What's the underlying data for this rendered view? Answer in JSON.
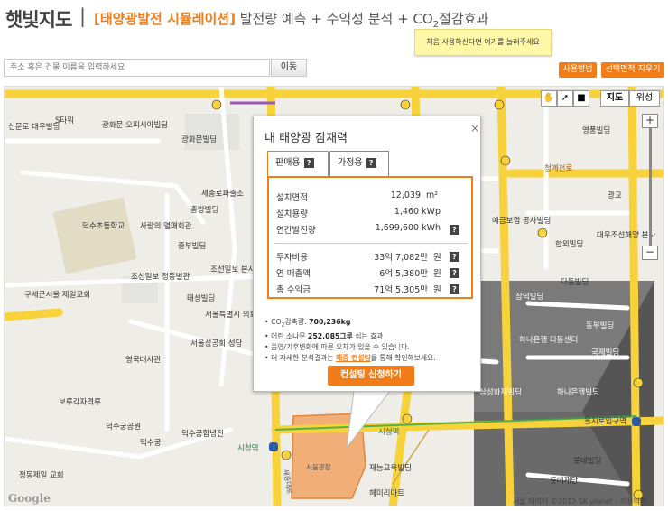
{
  "header": {
    "logo": "햇빛지도",
    "separator": "|",
    "title_highlight": "[태양광발전 시뮬레이션]",
    "title_rest": " 발전량 예측 + 수익성 분석 + CO",
    "title_sub": "2",
    "title_tail": "절감효과"
  },
  "tooltip": "처음 사용하신다면 여기를 눌러주세요",
  "search": {
    "placeholder": "주소 혹은 건물 이름을 입력하세요",
    "button": "이동"
  },
  "buttons": {
    "howto": "사용방법",
    "clear": "선택면적 지우기"
  },
  "map_controls": {
    "map": "지도",
    "satellite": "위성",
    "zoom_in": "+",
    "zoom_out": "−"
  },
  "map_labels": [
    "S타워",
    "광화문 오피시아빌딩",
    "신문로 대우빌딩",
    "광화문빌딩",
    "세종로파출소",
    "충방빌딩",
    "덕수초등학교",
    "사랑의 열매회관",
    "중부빌딩",
    "조선일보 정동별관",
    "조선일보 본사",
    "구세군서울 제일교회",
    "태성빌딩",
    "서울특별시 의회",
    "서울성공회 성당",
    "영국대사관",
    "보루각자격루",
    "덕수궁공원",
    "덕수궁함녕전",
    "덕수궁",
    "시청역",
    "정동제일 교회",
    "서울광장",
    "재능교육빌딩",
    "헤미리마트",
    "세종대로",
    "예금보험 공사빌딩",
    "한외빌딩",
    "대우조선해양 본사",
    "영풍빌딩",
    "청계천로",
    "광교",
    "다동빌딩",
    "삼덕빌딩",
    "동부빌딩",
    "국제빌딩",
    "하나은행 다동센터",
    "삼성화재빌딩",
    "하나은행빌딩",
    "을지로입구역",
    "롯데빌딩",
    "롯데재단",
    "시청역"
  ],
  "map_footer": {
    "google": "Google",
    "copyright": "서울 데이터 ©2013 SK planet - 이용약관"
  },
  "popup": {
    "title": "내 태양광 잠재력",
    "close": "×",
    "tabs": [
      {
        "label": "판매용",
        "active": true
      },
      {
        "label": "가정용",
        "active": false
      }
    ],
    "rows": [
      {
        "label": "설치면적",
        "value": "12,039",
        "unit": "m²"
      },
      {
        "label": "설치용량",
        "value": "1,460 kWp",
        "unit": ""
      },
      {
        "label": "연간발전량",
        "value": "1,699,600 kWh",
        "unit": ""
      },
      {
        "label": "투자비용",
        "value": "33억 7,082만",
        "unit": "원"
      },
      {
        "label": "연 매출액",
        "value": "6억 5,380만",
        "unit": "원"
      },
      {
        "label": "총 수익금",
        "value": "71억 5,305만",
        "unit": "원"
      }
    ],
    "notes": {
      "co2_label": "CO",
      "co2_sub": "2",
      "co2_rest": "감축량: ",
      "co2_value": "700,236kg",
      "tree_pre": "어린 소나무 ",
      "tree_value": "252,085그루",
      "tree_post": " 심는 효과",
      "weather": "음영/기후변화에 따른 오차가 있을 수 있습니다.",
      "detail_pre": "더 자세한 분석결과는 ",
      "detail_link": "해줌 컨설팅",
      "detail_post": "을 통해 확인해보세요."
    },
    "consult_button": "컨설팅 신청하기"
  },
  "colors": {
    "accent": "#f07d1a",
    "road": "#f7d23b",
    "tooltip": "#fff7a8"
  }
}
